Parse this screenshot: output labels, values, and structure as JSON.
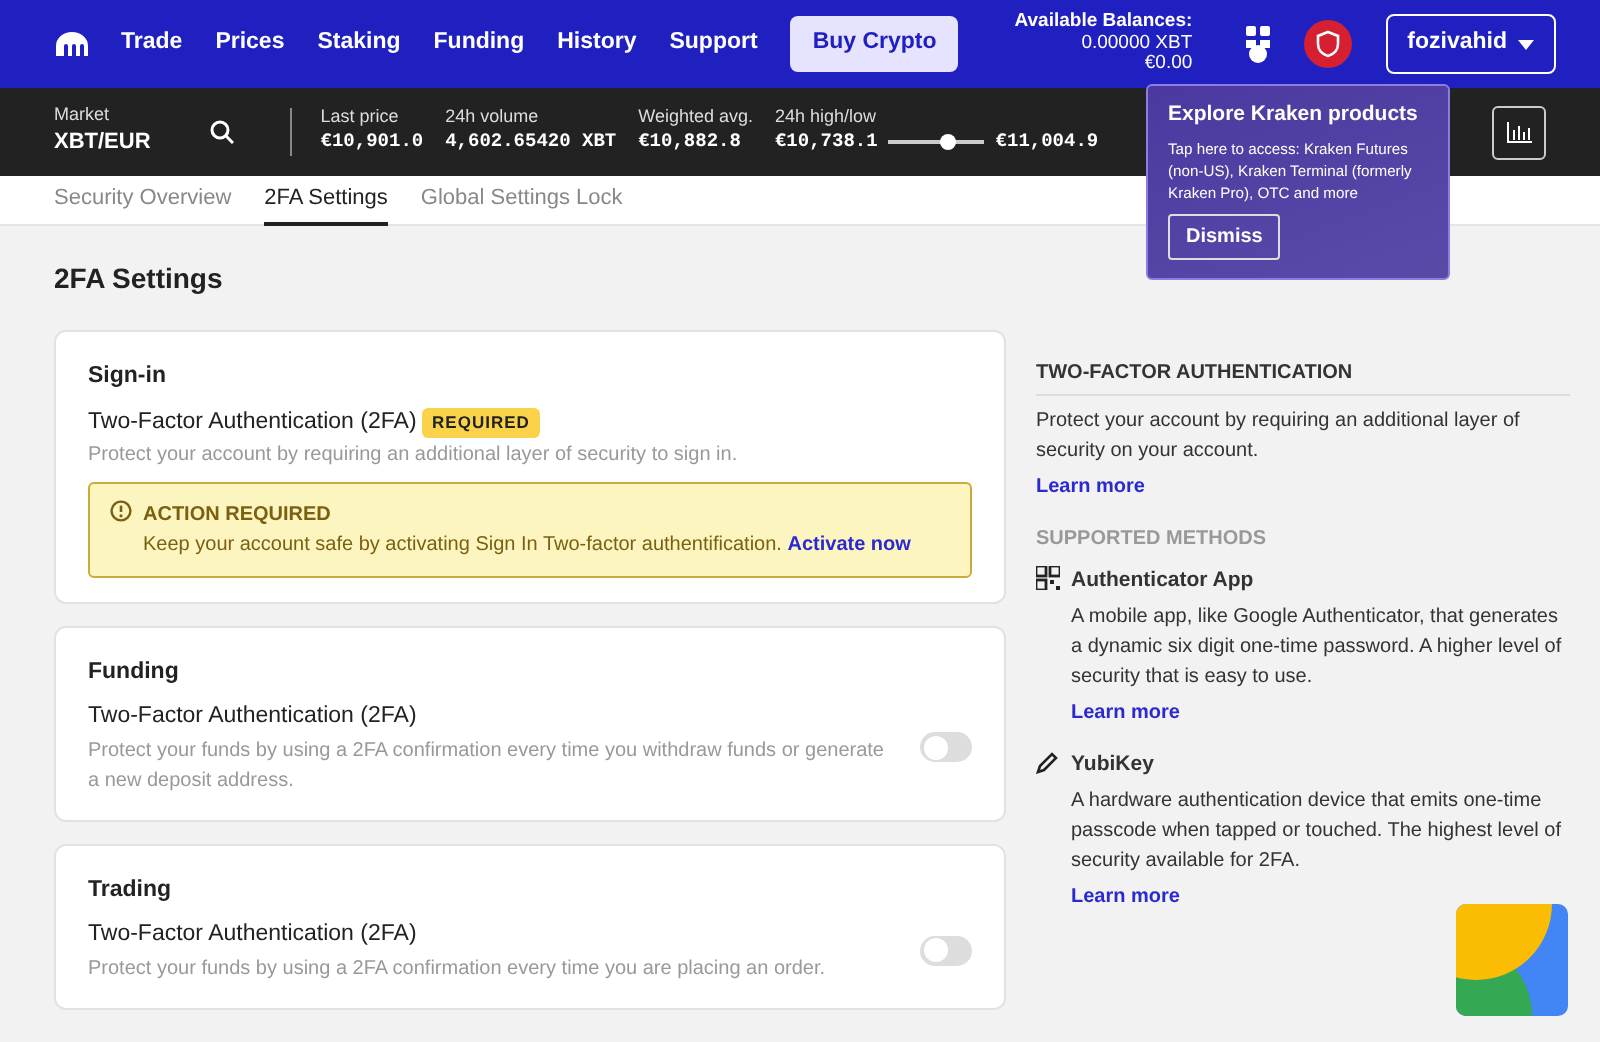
{
  "nav": {
    "items": [
      "Trade",
      "Prices",
      "Staking",
      "Funding",
      "History",
      "Support"
    ],
    "cta": "Buy Crypto",
    "balances": {
      "label": "Available Balances:",
      "lines": [
        "0.00000 XBT",
        "€0.00"
      ]
    },
    "user": "fozivahid"
  },
  "market": {
    "label": "Market",
    "pair": "XBT/EUR",
    "stats": [
      {
        "label": "Last price",
        "value": "€10,901.0"
      },
      {
        "label": "24h volume",
        "value": "4,602.65420 XBT"
      },
      {
        "label": "Weighted avg.",
        "value": "€10,882.8"
      }
    ],
    "range": {
      "label": "24h high/low",
      "low": "€10,738.1",
      "high": "€11,004.9",
      "level": 0.62
    }
  },
  "tabs": [
    {
      "label": "Security Overview",
      "selected": false
    },
    {
      "label": "2FA Settings",
      "selected": true
    },
    {
      "label": "Global Settings Lock",
      "selected": false
    }
  ],
  "popover": {
    "title": "Explore Kraken products",
    "text": "Tap here to access: Kraken Futures (non-US), Kraken Terminal (formerly Kraken Pro), OTC and more",
    "button": "Dismiss"
  },
  "page_title": "2FA Settings",
  "sections": [
    {
      "title": "Sign-in",
      "setting": "Two-Factor Authentication (2FA)",
      "badge": "REQUIRED",
      "description": "Protect your account by requiring an additional layer of security to sign in.",
      "alert": {
        "title": "ACTION REQUIRED",
        "text": "Keep your account safe by activating Sign In Two-factor authentification.",
        "link": "Activate now"
      }
    },
    {
      "title": "Funding",
      "setting": "Two-Factor Authentication (2FA)",
      "description": "Protect your funds by using a 2FA confirmation every time you withdraw funds or generate a new deposit address.",
      "on": false
    },
    {
      "title": "Trading",
      "setting": "Two-Factor Authentication (2FA)",
      "description": "Protect your funds by using a 2FA confirmation every time you are placing an order.",
      "on": false
    }
  ],
  "aside": {
    "title": "TWO-FACTOR AUTHENTICATION",
    "text": "Protect your account by requiring an additional layer of security on your account.",
    "link": "Learn more",
    "methods_title": "SUPPORTED METHODS",
    "methods": [
      {
        "kind": "app",
        "name": "Authenticator App",
        "text": "A mobile app, like Google Authenticator, that generates a dynamic six digit one-time password. A higher level of security that is easy to use.",
        "link": "Learn more"
      },
      {
        "kind": "key",
        "name": "YubiKey",
        "text": "A hardware authentication device that emits one-time passcode when tapped or touched. The highest level of security available for 2FA.",
        "link": "Learn more"
      }
    ]
  }
}
